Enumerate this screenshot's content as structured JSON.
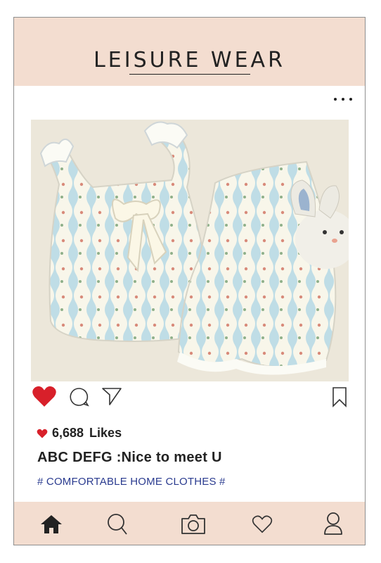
{
  "header": {
    "title": "LEISURE WEAR"
  },
  "post": {
    "photo_icon": "pajama-set-photo",
    "likes_count": "6,688",
    "likes_label": "Likes",
    "caption": "ABC DEFG :Nice to meet U",
    "hashtag": "# COMFORTABLE HOME CLOTHES #"
  },
  "actions": [
    "heart-icon",
    "comment-icon",
    "share-icon",
    "bookmark-icon"
  ],
  "nav": [
    "home-icon",
    "search-icon",
    "camera-icon",
    "heart-icon",
    "profile-icon"
  ],
  "colors": {
    "header_bg": "#f3ddd0",
    "like_red": "#d8202a",
    "hashtag_blue": "#2a3b8f"
  }
}
